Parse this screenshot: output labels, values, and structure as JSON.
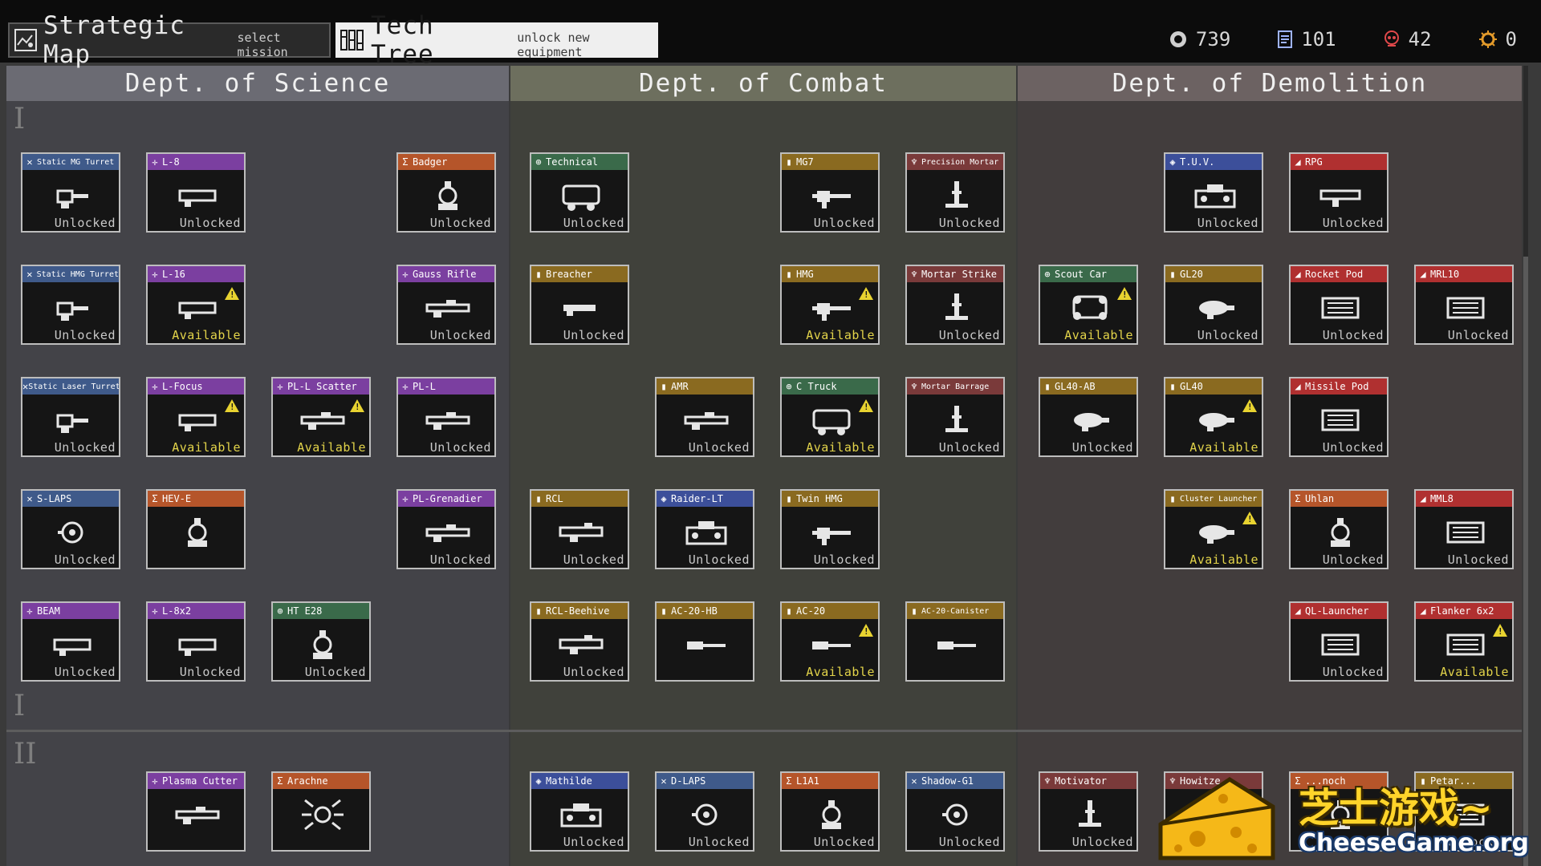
{
  "tabs": [
    {
      "title": "Strategic Map",
      "subtitle": "select mission",
      "icon": "map-icon"
    },
    {
      "title": "Tech Tree",
      "subtitle": "unlock new equipment",
      "icon": "tech-tree-icon"
    }
  ],
  "resources": [
    {
      "name": "credits",
      "icon": "coin-icon",
      "value": "739",
      "color": "#cfcfcf"
    },
    {
      "name": "intel",
      "icon": "document-icon",
      "value": "101",
      "color": "#9fb4ff"
    },
    {
      "name": "casualties",
      "icon": "skull-icon",
      "value": "42",
      "color": "#e0484a"
    },
    {
      "name": "research",
      "icon": "gear-icon",
      "value": "0",
      "color": "#e39a2a"
    }
  ],
  "departments": [
    {
      "name": "Dept. of Science",
      "head_color": "#6b6b73",
      "col_color": "#434348"
    },
    {
      "name": "Dept. of Combat",
      "head_color": "#6d6f5e",
      "col_color": "#40413b"
    },
    {
      "name": "Dept. of Demolition",
      "head_color": "#6c6262",
      "col_color": "#423d3d"
    }
  ],
  "tiers": [
    "I",
    "I",
    "II"
  ],
  "categories": {
    "science": {
      "color": "#7b3fa0",
      "glyph": "✛"
    },
    "combat": {
      "color": "#8a6a20",
      "glyph": "▮"
    },
    "demolition": {
      "color": "#b03030",
      "glyph": "◢"
    },
    "engineering": {
      "color": "#3f5a8a",
      "glyph": "✕"
    },
    "vehicle": {
      "color": "#3a6a4a",
      "glyph": "⊕"
    },
    "artillery": {
      "color": "#7a3a3a",
      "glyph": "♆"
    },
    "special": {
      "color": "#b5552a",
      "glyph": "Σ"
    },
    "transport": {
      "color": "#3c4f9a",
      "glyph": "◈"
    }
  },
  "nodes": [
    {
      "id": "n1",
      "name": "Static MG Turret",
      "cat": "engineering",
      "status": "Unlocked",
      "icon": "turret-icon"
    },
    {
      "id": "n2",
      "name": "L-8",
      "cat": "science",
      "status": "Unlocked",
      "icon": "laser-rifle-icon"
    },
    {
      "id": "n3",
      "name": "Badger",
      "cat": "special",
      "status": "Unlocked",
      "icon": "robot-icon"
    },
    {
      "id": "n4",
      "name": "Technical",
      "cat": "vehicle",
      "status": "Unlocked",
      "icon": "truck-icon"
    },
    {
      "id": "n5",
      "name": "MG7",
      "cat": "combat",
      "status": "Unlocked",
      "icon": "machine-gun-icon"
    },
    {
      "id": "n6",
      "name": "Precision Mortar",
      "cat": "artillery",
      "status": "Unlocked",
      "icon": "mortar-icon"
    },
    {
      "id": "n7",
      "name": "T.U.V.",
      "cat": "transport",
      "status": "Unlocked",
      "icon": "tank-icon"
    },
    {
      "id": "n8",
      "name": "RPG",
      "cat": "demolition",
      "status": "Unlocked",
      "icon": "rocket-launcher-icon"
    },
    {
      "id": "n9",
      "name": "Static HMG Turret",
      "cat": "engineering",
      "status": "Unlocked",
      "icon": "turret-icon"
    },
    {
      "id": "n10",
      "name": "L-16",
      "cat": "science",
      "status": "Available",
      "icon": "laser-rifle-icon",
      "warn": true
    },
    {
      "id": "n11",
      "name": "Gauss Rifle",
      "cat": "science",
      "status": "Unlocked",
      "icon": "rifle-icon"
    },
    {
      "id": "n12",
      "name": "Breacher",
      "cat": "combat",
      "status": "Unlocked",
      "icon": "shotgun-icon"
    },
    {
      "id": "n13",
      "name": "HMG",
      "cat": "combat",
      "status": "Available",
      "icon": "machine-gun-icon",
      "warn": true
    },
    {
      "id": "n14",
      "name": "Mortar Strike",
      "cat": "artillery",
      "status": "Unlocked",
      "icon": "mortar-icon"
    },
    {
      "id": "n15",
      "name": "Scout Car",
      "cat": "vehicle",
      "status": "Available",
      "icon": "car-icon",
      "warn": true
    },
    {
      "id": "n16",
      "name": "GL20",
      "cat": "combat",
      "status": "Unlocked",
      "icon": "grenade-launcher-icon"
    },
    {
      "id": "n17",
      "name": "Rocket Pod",
      "cat": "demolition",
      "status": "Unlocked",
      "icon": "rocket-pod-icon"
    },
    {
      "id": "n18",
      "name": "MRL10",
      "cat": "demolition",
      "status": "Unlocked",
      "icon": "rocket-pod-icon"
    },
    {
      "id": "n19",
      "name": "Static Laser Turret",
      "cat": "engineering",
      "status": "Unlocked",
      "icon": "turret-icon"
    },
    {
      "id": "n20",
      "name": "L-Focus",
      "cat": "science",
      "status": "Available",
      "icon": "laser-rifle-icon",
      "warn": true
    },
    {
      "id": "n21",
      "name": "PL-L Scatter",
      "cat": "science",
      "status": "Available",
      "icon": "rifle-icon",
      "warn": true
    },
    {
      "id": "n22",
      "name": "PL-L",
      "cat": "science",
      "status": "Unlocked",
      "icon": "rifle-icon"
    },
    {
      "id": "n23",
      "name": "AMR",
      "cat": "combat",
      "status": "Unlocked",
      "icon": "rifle-icon"
    },
    {
      "id": "n24",
      "name": "C Truck",
      "cat": "vehicle",
      "status": "Available",
      "icon": "truck-icon",
      "warn": true
    },
    {
      "id": "n25",
      "name": "Mortar Barrage",
      "cat": "artillery",
      "status": "Unlocked",
      "icon": "mortar-icon"
    },
    {
      "id": "n26",
      "name": "GL40-AB",
      "cat": "combat",
      "status": "Unlocked",
      "icon": "grenade-launcher-icon"
    },
    {
      "id": "n27",
      "name": "GL40",
      "cat": "combat",
      "status": "Available",
      "icon": "grenade-launcher-icon",
      "warn": true
    },
    {
      "id": "n28",
      "name": "Missile Pod",
      "cat": "demolition",
      "status": "Unlocked",
      "icon": "rocket-pod-icon"
    },
    {
      "id": "n29",
      "name": "S-LAPS",
      "cat": "engineering",
      "status": "Unlocked",
      "icon": "drone-icon"
    },
    {
      "id": "n30",
      "name": "HEV-E",
      "cat": "special",
      "status": "",
      "icon": "robot-icon"
    },
    {
      "id": "n31",
      "name": "PL-Grenadier",
      "cat": "science",
      "status": "Unlocked",
      "icon": "rifle-icon"
    },
    {
      "id": "n32",
      "name": "RCL",
      "cat": "combat",
      "status": "Unlocked",
      "icon": "recoilless-icon"
    },
    {
      "id": "n33",
      "name": "Raider-LT",
      "cat": "transport",
      "status": "Unlocked",
      "icon": "tank-icon"
    },
    {
      "id": "n34",
      "name": "Twin HMG",
      "cat": "combat",
      "status": "Unlocked",
      "icon": "machine-gun-icon"
    },
    {
      "id": "n35",
      "name": "Cluster Launcher",
      "cat": "combat",
      "status": "Available",
      "icon": "grenade-launcher-icon",
      "warn": true
    },
    {
      "id": "n36",
      "name": "Uhlan",
      "cat": "special",
      "status": "Unlocked",
      "icon": "robot-icon"
    },
    {
      "id": "n37",
      "name": "MML8",
      "cat": "demolition",
      "status": "Unlocked",
      "icon": "rocket-pod-icon"
    },
    {
      "id": "n38",
      "name": "BEAM",
      "cat": "science",
      "status": "Unlocked",
      "icon": "laser-rifle-icon"
    },
    {
      "id": "n39",
      "name": "L-8x2",
      "cat": "science",
      "status": "Unlocked",
      "icon": "laser-rifle-icon"
    },
    {
      "id": "n40",
      "name": "HT E28",
      "cat": "vehicle",
      "status": "Unlocked",
      "icon": "robot-icon"
    },
    {
      "id": "n41",
      "name": "RCL-Beehive",
      "cat": "combat",
      "status": "Unlocked",
      "icon": "recoilless-icon"
    },
    {
      "id": "n42",
      "name": "AC-20-HB",
      "cat": "combat",
      "status": "",
      "icon": "cannon-icon"
    },
    {
      "id": "n43",
      "name": "AC-20",
      "cat": "combat",
      "status": "Available",
      "icon": "cannon-icon",
      "warn": true
    },
    {
      "id": "n44",
      "name": "AC-20-Canister",
      "cat": "combat",
      "status": "",
      "icon": "cannon-icon"
    },
    {
      "id": "n45",
      "name": "QL-Launcher",
      "cat": "demolition",
      "status": "Unlocked",
      "icon": "rocket-pod-icon"
    },
    {
      "id": "n46",
      "name": "Flanker 6x2",
      "cat": "demolition",
      "status": "Available",
      "icon": "rocket-pod-icon",
      "warn": true
    },
    {
      "id": "n47",
      "name": "Plasma Cutter",
      "cat": "science",
      "status": "",
      "icon": "rifle-icon"
    },
    {
      "id": "n48",
      "name": "Arachne",
      "cat": "special",
      "status": "",
      "icon": "spider-icon"
    },
    {
      "id": "n49",
      "name": "Mathilde",
      "cat": "transport",
      "status": "Unlocked",
      "icon": "tank-icon"
    },
    {
      "id": "n50",
      "name": "D-LAPS",
      "cat": "engineering",
      "status": "Unlocked",
      "icon": "drone-icon"
    },
    {
      "id": "n51",
      "name": "L1A1",
      "cat": "special",
      "status": "Unlocked",
      "icon": "robot-icon"
    },
    {
      "id": "n52",
      "name": "Shadow-G1",
      "cat": "engineering",
      "status": "Unlocked",
      "icon": "drone-icon"
    },
    {
      "id": "n53",
      "name": "Motivator",
      "cat": "artillery",
      "status": "Unlocked",
      "icon": "mortar-icon"
    },
    {
      "id": "n54",
      "name": "Howitze",
      "cat": "artillery",
      "status": "",
      "icon": "cannon-icon"
    },
    {
      "id": "n55",
      "name": "...noch",
      "cat": "special",
      "status": "",
      "icon": "robot-icon"
    },
    {
      "id": "n56",
      "name": "Petar...",
      "cat": "combat",
      "status": "Unlocked",
      "icon": "rocket-pod-icon"
    }
  ],
  "watermark": {
    "chinese": "芝士游戏~",
    "english": "CheeseGame.org"
  }
}
